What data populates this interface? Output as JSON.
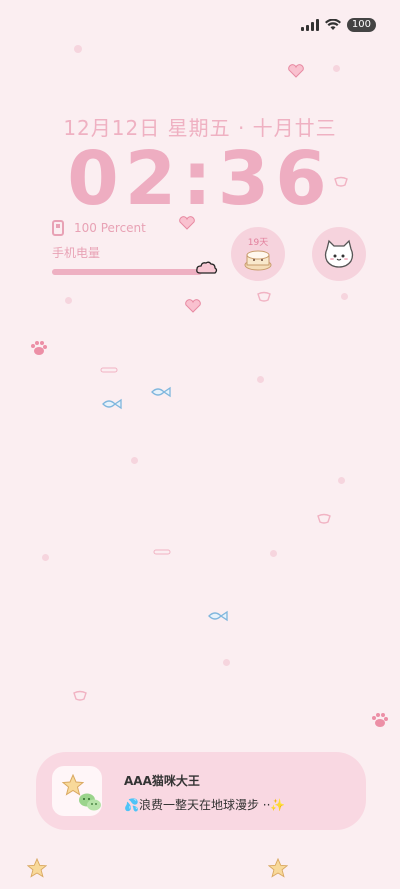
{
  "status_bar": {
    "battery_level": "100",
    "signal_bars": 4,
    "wifi": "wifi-icon"
  },
  "lock": {
    "date_line": "12月12日 星期五 · 十月廿三",
    "time": "02:36"
  },
  "battery_widget": {
    "percent_text": "100  Percent",
    "label": "手机电量",
    "level_fraction": 1.0
  },
  "widgets": {
    "days_text": "19天",
    "icon_a": "cake-icon",
    "icon_b": "cat-face-icon"
  },
  "notification": {
    "title": "AAA猫咪大王",
    "body": "💦浪费一整天在地球漫步 ··✨",
    "app_icon": "wechat-icon"
  },
  "colors": {
    "background": "#fbeef1",
    "accent_pink": "#eeadc1",
    "note_bg": "#f9d8e2"
  }
}
